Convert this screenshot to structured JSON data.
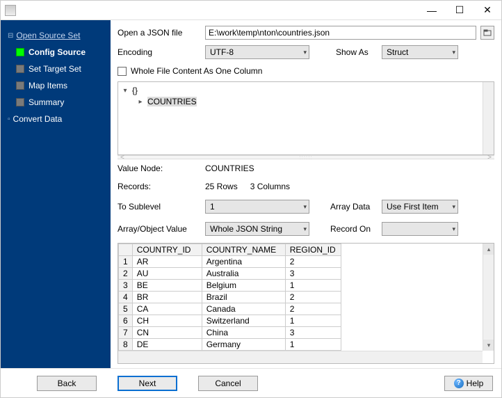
{
  "window": {
    "minimize": "—",
    "maximize": "☐",
    "close": "✕"
  },
  "sidebar": {
    "items": [
      {
        "label": "Open Source Set",
        "link": true
      },
      {
        "label": "Config Source",
        "active": true
      },
      {
        "label": "Set Target Set"
      },
      {
        "label": "Map Items"
      },
      {
        "label": "Summary"
      },
      {
        "label": "Convert Data"
      }
    ]
  },
  "form": {
    "open_label": "Open a JSON file",
    "file_path": "E:\\work\\temp\\nton\\countries.json",
    "encoding_label": "Encoding",
    "encoding_value": "UTF-8",
    "showas_label": "Show As",
    "showas_value": "Struct",
    "whole_file_checkbox": "Whole File Content As One Column"
  },
  "tree": {
    "root": "{}",
    "child": "COUNTRIES"
  },
  "info": {
    "value_node_label": "Value Node:",
    "value_node": "COUNTRIES",
    "records_label": "Records:",
    "records_rows": "25 Rows",
    "records_cols": "3 Columns",
    "sublevel_label": "To Sublevel",
    "sublevel_value": "1",
    "arraydata_label": "Array Data",
    "arraydata_value": "Use First Item",
    "objvalue_label": "Array/Object Value",
    "objvalue_value": "Whole JSON String",
    "recordon_label": "Record On",
    "recordon_value": ""
  },
  "chart_data": {
    "type": "table",
    "columns": [
      "COUNTRY_ID",
      "COUNTRY_NAME",
      "REGION_ID"
    ],
    "rows": [
      [
        "AR",
        "Argentina",
        "2"
      ],
      [
        "AU",
        "Australia",
        "3"
      ],
      [
        "BE",
        "Belgium",
        "1"
      ],
      [
        "BR",
        "Brazil",
        "2"
      ],
      [
        "CA",
        "Canada",
        "2"
      ],
      [
        "CH",
        "Switzerland",
        "1"
      ],
      [
        "CN",
        "China",
        "3"
      ],
      [
        "DE",
        "Germany",
        "1"
      ]
    ]
  },
  "buttons": {
    "back": "Back",
    "next": "Next",
    "cancel": "Cancel",
    "help": "Help"
  }
}
